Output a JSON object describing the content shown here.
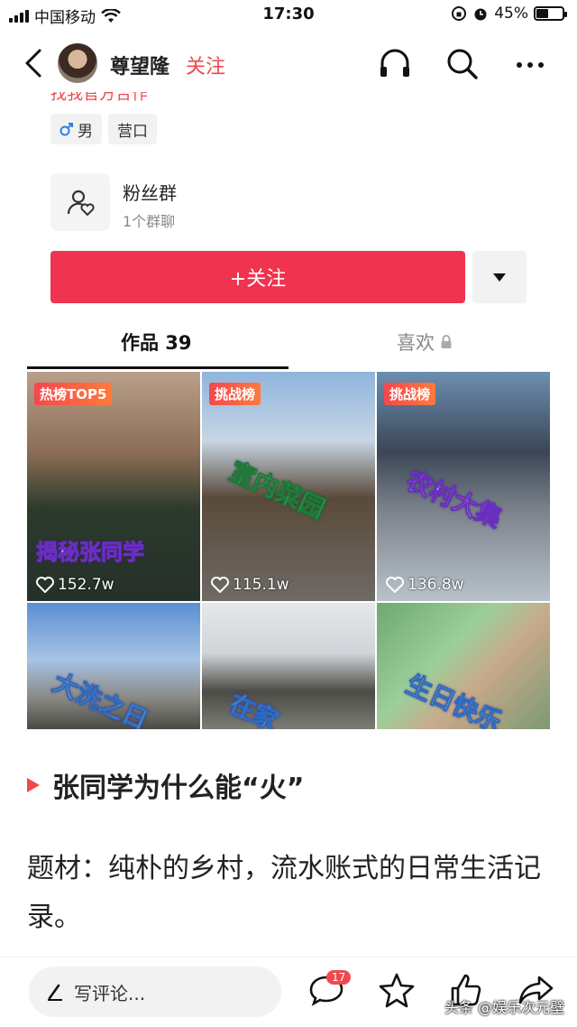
{
  "status_bar": {
    "carrier": "中国移动",
    "time": "17:30",
    "battery_percent": "45%",
    "battery_level": 0.45
  },
  "nav": {
    "name": "尊望隆",
    "follow_label": "关注"
  },
  "profile": {
    "title_cut": "找我官方合作",
    "gender_tag": "男",
    "location_tag": "营口",
    "fans_group_title": "粉丝群",
    "fans_group_sub": "1个群聊",
    "follow_button": "+关注",
    "tabs": {
      "works": "作品 39",
      "likes": "喜欢"
    }
  },
  "videos": [
    {
      "badge": "热榜TOP5",
      "overlay": "揭秘张同学",
      "likes": "152.7w"
    },
    {
      "badge": "挑战榜",
      "overlay": "室内菜园",
      "likes": "115.1w"
    },
    {
      "badge": "挑战榜",
      "overlay": "农村大集",
      "likes": "136.8w"
    },
    {
      "badge": "",
      "overlay": "大洗之日",
      "likes": ""
    },
    {
      "badge": "",
      "overlay": "在家",
      "likes": ""
    },
    {
      "badge": "",
      "overlay": "生日快乐",
      "likes": ""
    }
  ],
  "article": {
    "heading": "张同学为什么能“火”",
    "body": "题材：纯朴的乡村，流水账式的日常生活记录。"
  },
  "bottom_bar": {
    "comment_placeholder": "写评论...",
    "comment_count": "17",
    "watermark": "头条 @娱乐次元壁"
  },
  "colors": {
    "accent": "#f0484e",
    "follow_button": "#f0334f"
  },
  "icons": [
    "back-icon",
    "headphones-icon",
    "search-icon",
    "more-icon",
    "male-icon",
    "fans-group-icon",
    "dropdown-icon",
    "lock-icon",
    "heart-icon",
    "pen-icon",
    "comment-icon",
    "star-icon",
    "like-icon",
    "share-icon"
  ]
}
